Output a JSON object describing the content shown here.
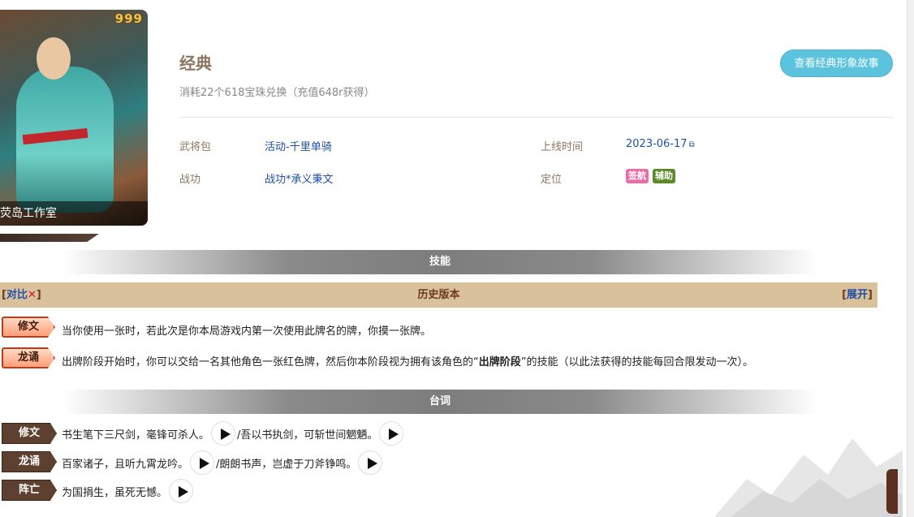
{
  "portrait": {
    "badge": "999",
    "caption": "荧岛工作室"
  },
  "header": {
    "title": "经典",
    "subtitle": "消耗22个618宝珠兑换（充值648r获得）",
    "story_button": "查看经典形象故事"
  },
  "info": {
    "pack_label": "武将包",
    "pack_value": "活动-千里单骑",
    "online_label": "上线时间",
    "online_value": "2023-06-17",
    "merit_label": "战功",
    "merit_value": "战功*承义秉文",
    "position_label": "定位",
    "tags": [
      {
        "label": "签航",
        "color": "#e86ca6"
      },
      {
        "label": "辅助",
        "color": "#5c8a2a"
      }
    ]
  },
  "skills_section": {
    "title": "技能",
    "history": {
      "left_open": "[",
      "left_link": "对比",
      "left_x": "✕",
      "left_close": "]",
      "center": "历史版本",
      "right_open": "[",
      "right_link": "展开",
      "right_close": "]"
    },
    "items": [
      {
        "name": "修文",
        "text": "当你使用一张时，若此次是你本局游戏内第一次使用此牌名的牌，你摸一张牌。"
      },
      {
        "name": "龙诵",
        "text_before": "出牌阶段开始时，你可以交给一名其他角色一张红色牌，然后你本阶段视为拥有该角色的“",
        "text_bold": "出牌阶段",
        "text_after": "”的技能（以此法获得的技能每回合限发动一次）。"
      }
    ]
  },
  "lines_section": {
    "title": "台词",
    "items": [
      {
        "name": "修文",
        "line1": "书生笔下三尺剑，毫锋可杀人。",
        "line2": "/吾以书执剑，可斩世间魍魉。"
      },
      {
        "name": "龙诵",
        "line1": "百家诸子，且听九霄龙吟。",
        "line2": "/朗朗书声，岂虚于刀斧铮鸣。"
      },
      {
        "name": "阵亡",
        "line1": "为国捐生，虽死无憾。"
      }
    ]
  }
}
